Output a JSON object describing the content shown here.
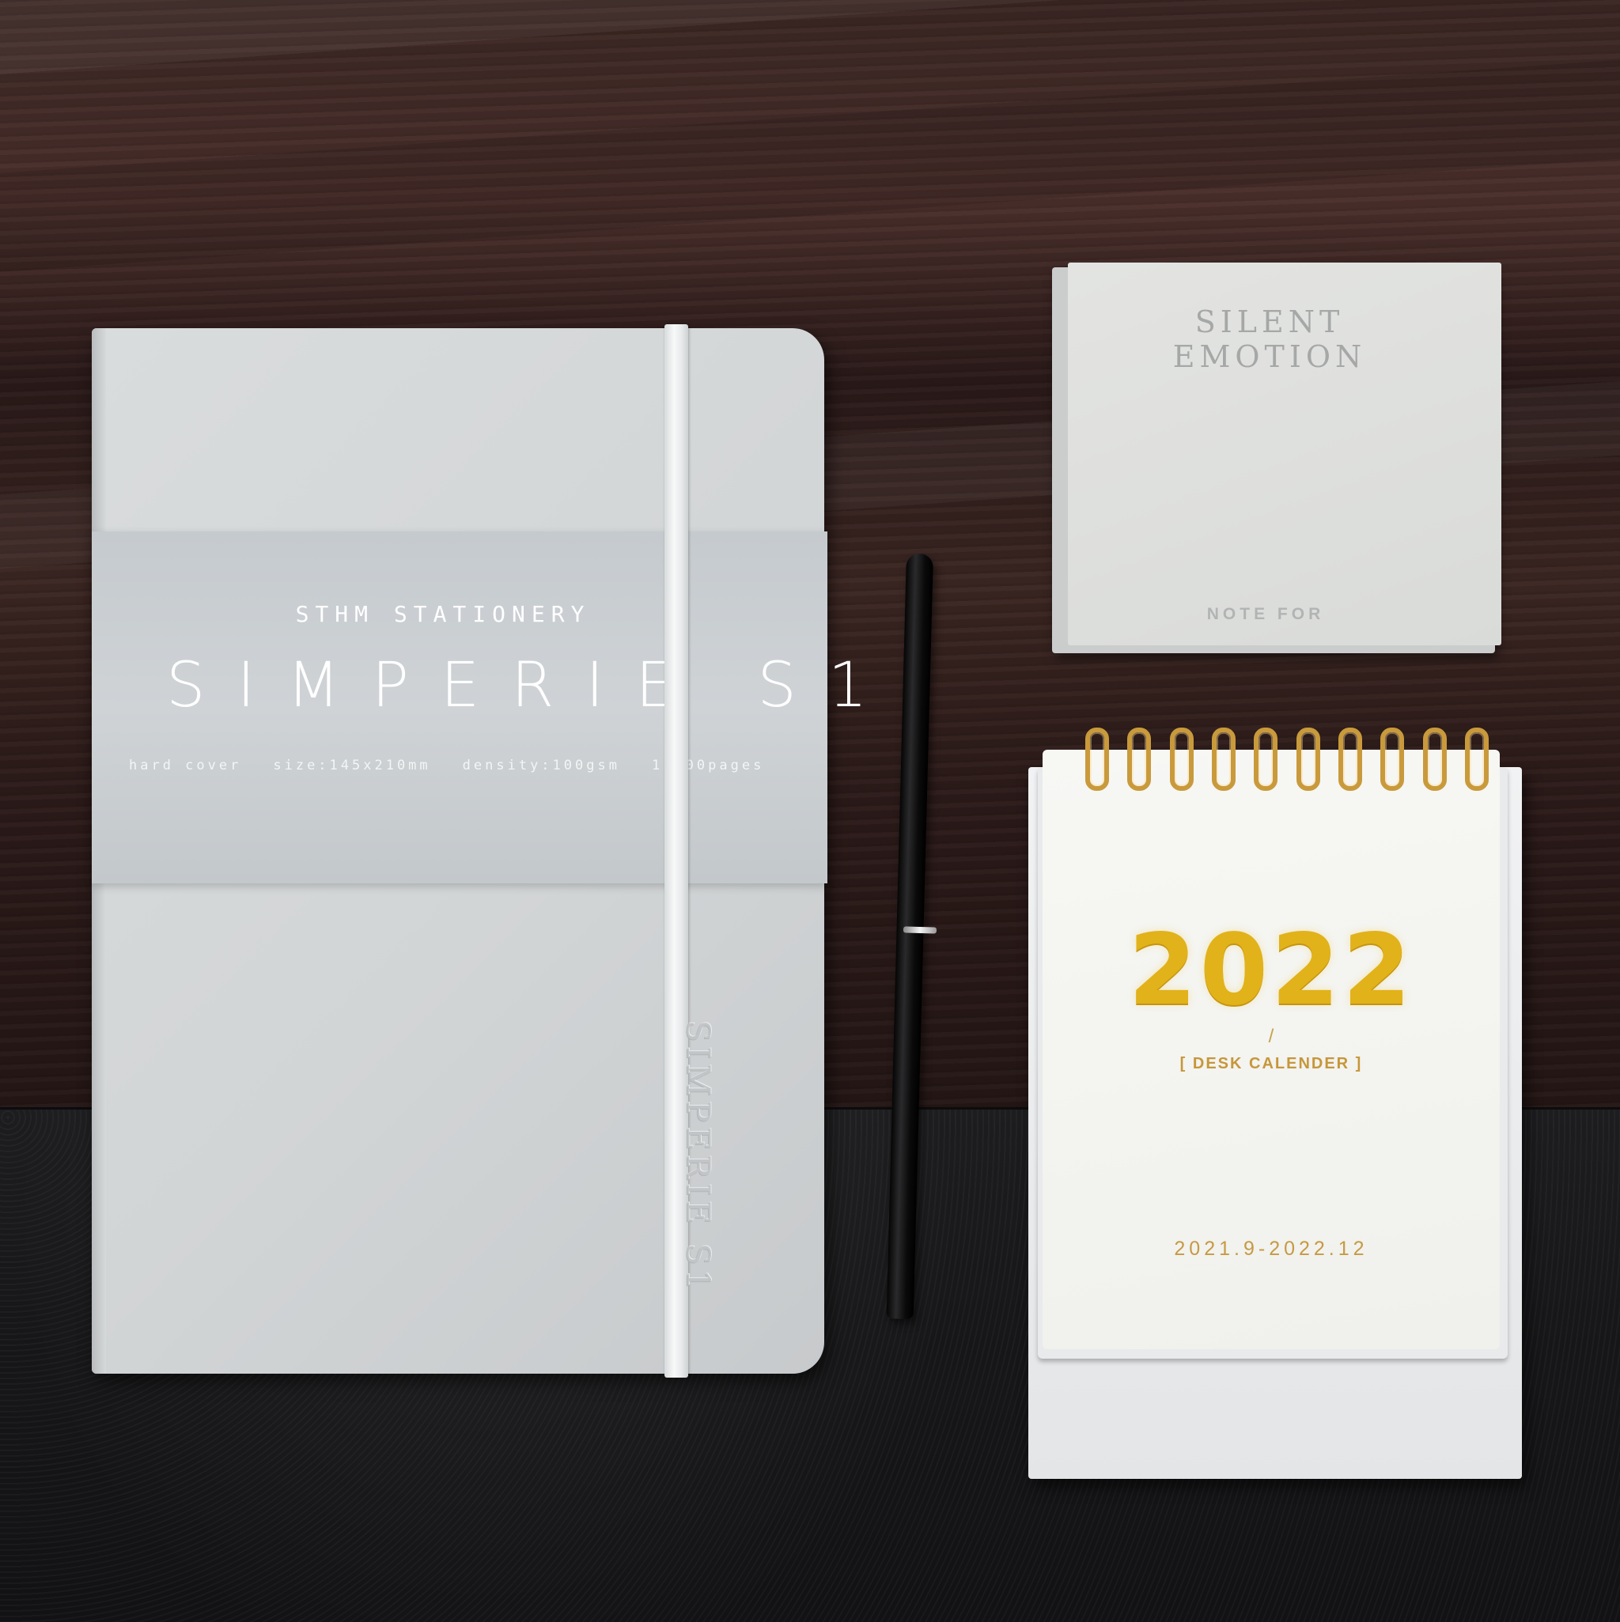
{
  "scene": {
    "desk_color": "#3a2623",
    "leather_color": "#171719"
  },
  "notebook": {
    "brand": "STHM STATIONERY",
    "title": "SIMPERIE S1",
    "specs": [
      "hard cover",
      "size:145x210mm",
      "density:100gsm",
      "1-200pages"
    ],
    "spine_emboss": "SIMPERIE S1",
    "color": "#d5d8d9"
  },
  "sticky_notes": {
    "title": "SILENT EMOTION",
    "footer": "NOTE FOR"
  },
  "desk_calendar": {
    "year": "2022",
    "slash": "/",
    "subtitle": "[ DESK CALENDER ]",
    "range": "2021.9-2022.12",
    "accent_color": "#e1b21a",
    "ring_count": 10
  }
}
